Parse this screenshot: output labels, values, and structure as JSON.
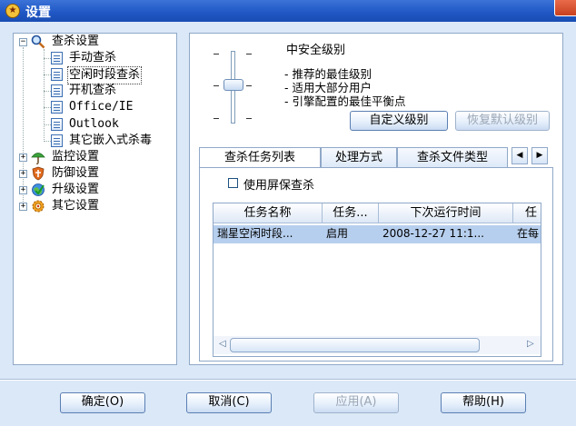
{
  "window": {
    "title": "设置"
  },
  "tree": {
    "items": [
      {
        "label": "查杀设置",
        "icon": "magnifier-icon"
      },
      {
        "label": "手动查杀",
        "icon": "document-icon"
      },
      {
        "label": "空闲时段查杀",
        "icon": "document-icon"
      },
      {
        "label": "开机查杀",
        "icon": "document-icon"
      },
      {
        "label": "Office/IE",
        "icon": "document-icon"
      },
      {
        "label": "Outlook",
        "icon": "document-icon"
      },
      {
        "label": "其它嵌入式杀毒",
        "icon": "document-icon"
      },
      {
        "label": "监控设置",
        "icon": "umbrella-icon"
      },
      {
        "label": "防御设置",
        "icon": "shield-icon"
      },
      {
        "label": "升级设置",
        "icon": "globe-icon"
      },
      {
        "label": "其它设置",
        "icon": "gear-icon"
      }
    ],
    "expand_minus": "−",
    "expand_plus": "+"
  },
  "security": {
    "level_title": "中安全级别",
    "desc1": "- 推荐的最佳级别",
    "desc2": "- 适用大部分用户",
    "desc3": "- 引擎配置的最佳平衡点",
    "custom_btn": "自定义级别",
    "restore_btn": "恢复默认级别",
    "slider_level": 0.5
  },
  "tabs": {
    "items": [
      "查杀任务列表",
      "处理方式",
      "查杀文件类型"
    ],
    "left_arrow": "◀",
    "right_arrow": "▶"
  },
  "task_panel": {
    "screensaver_label": "使用屏保查杀",
    "columns": [
      "任务名称",
      "任务...",
      "下次运行时间",
      "任"
    ],
    "rows": [
      [
        "瑞星空闲时段...",
        "启用",
        "2008-12-27 11:1...",
        "在每"
      ]
    ],
    "scroll_left": "◁",
    "scroll_right": "▷"
  },
  "buttons": {
    "ok": "确定(O)",
    "cancel": "取消(C)",
    "apply": "应用(A)",
    "help": "帮助(H)"
  }
}
